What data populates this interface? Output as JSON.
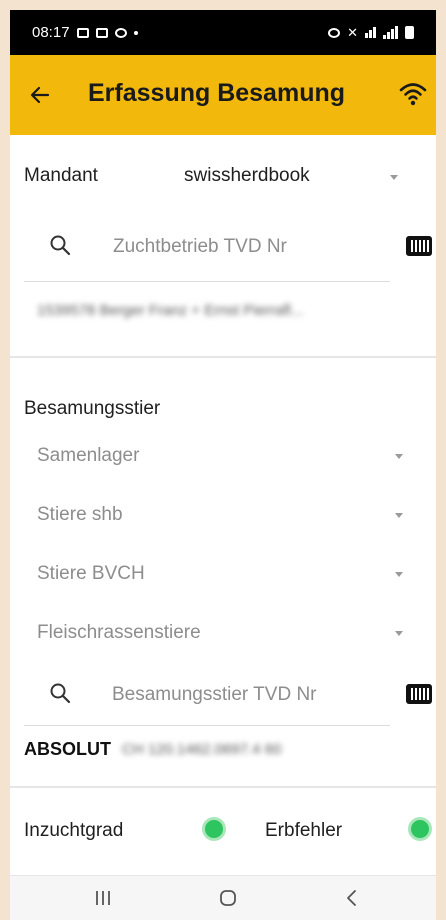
{
  "status_bar": {
    "time": "08:17",
    "icons": [
      "gallery-icon",
      "mail-icon",
      "whatsapp-icon",
      "dot-icon",
      "alarm-icon",
      "mute-icon",
      "wifi-signal-icon",
      "cell-signal-icon",
      "battery-icon"
    ]
  },
  "app_bar": {
    "title": "Erfassung Besamung",
    "back_icon": "arrow-left-icon",
    "connectivity_icon": "wifi-icon",
    "color": "#f2b90c"
  },
  "mandant": {
    "label": "Mandant",
    "value": "swissherdbook"
  },
  "farm_search": {
    "placeholder": "Zuchtbetrieb TVD Nr",
    "result": "1539578 Berger Franz + Ernst Pierrafl..."
  },
  "bull_section": {
    "title": "Besamungsstier",
    "dropdowns": [
      "Samenlager",
      "Stiere shb",
      "Stiere BVCH",
      "Fleischrassenstiere"
    ],
    "search_placeholder": "Besamungsstier TVD Nr",
    "selected_name": "ABSOLUT",
    "selected_id": "CH 120.1462.0697.4 60"
  },
  "indicators": {
    "inzucht_label": "Inzuchtgrad",
    "erbfehler_label": "Erbfehler",
    "ok_color": "#2ec45f"
  },
  "nav_bar": {
    "icons": [
      "recent-apps-icon",
      "home-icon",
      "back-chevron-icon"
    ]
  }
}
